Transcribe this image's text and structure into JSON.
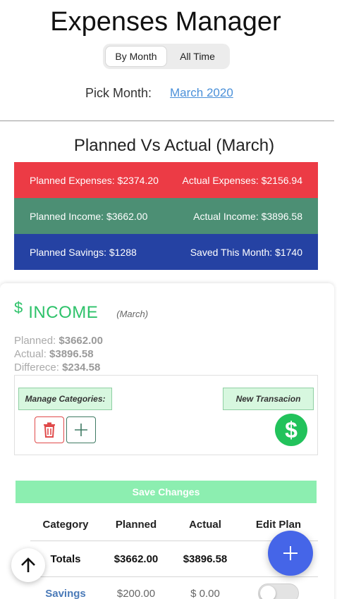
{
  "app": {
    "title": "Expenses Manager"
  },
  "view_toggle": {
    "options": [
      "By Month",
      "All Time"
    ],
    "selected": "By Month"
  },
  "pick_month": {
    "label": "Pick Month:",
    "value": "March 2020"
  },
  "planned_vs_actual": {
    "title": "Planned Vs Actual (March)",
    "rows": [
      {
        "left": "Planned Expenses:  $2374.20",
        "right": "Actual Expenses:  $2156.94",
        "color": "#ec3b45"
      },
      {
        "left": "Planned Income:  $3662.00",
        "right": "Actual Income:  $3896.58",
        "color": "#4c8f74"
      },
      {
        "left": "Planned Savings:  $1288",
        "right": "Saved This Month:  $1740",
        "color": "#2542a3"
      }
    ]
  },
  "income": {
    "icon": "$",
    "title": "INCOME",
    "month": "(March)",
    "planned_label": "Planned:",
    "planned_value": "$3662.00",
    "actual_label": "Actual:",
    "actual_value": "$3896.58",
    "difference_label": "Differece:",
    "difference_value": "$234.58",
    "manage_categories": "Manage Categories:",
    "new_transaction": "New Transacion",
    "save_changes": "Save Changes",
    "table": {
      "headers": [
        "Category",
        "Planned",
        "Actual",
        "Edit Plan"
      ],
      "totals": [
        "Totals",
        "$3662.00",
        "$3896.58"
      ],
      "rows": [
        {
          "category": "Savings",
          "planned": "$200.00",
          "actual": "$ 0.00"
        }
      ]
    }
  },
  "colors": {
    "accent_green": "#2ec26a",
    "fab_blue": "#4565e8",
    "link_blue": "#4a90d9"
  }
}
